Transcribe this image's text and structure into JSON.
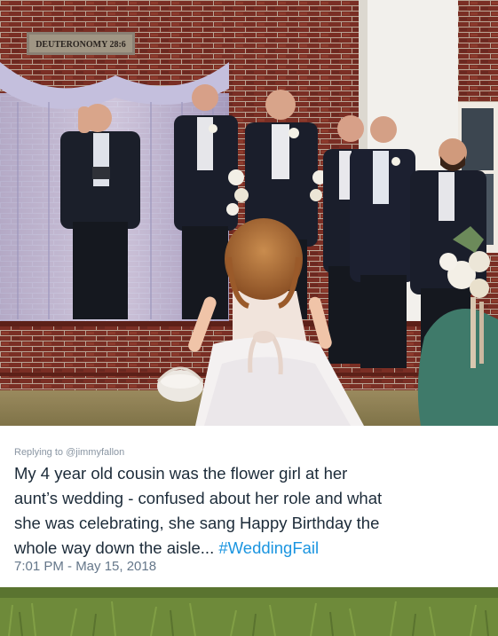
{
  "photo": {
    "sign_text": "DEUTERONOMY 28:6",
    "icon": "wedding-photo"
  },
  "tweet": {
    "replying_prefix": "Replying to ",
    "replying_handle": "@jimmyfallon",
    "text_line1": "My 4 year old cousin was the flower girl at her",
    "text_line2": "aunt’s wedding - confused about her role and what",
    "text_line3": "she was celebrating, she sang Happy Birthday the",
    "text_line4": "whole way down the aisle...",
    "hashtag": "#WeddingFail",
    "timestamp": "7:01 PM - May 15, 2018",
    "hashtag_color": "#1b95e0"
  }
}
